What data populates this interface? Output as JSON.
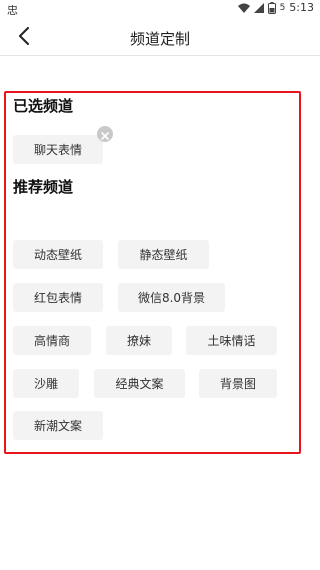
{
  "status_bar": {
    "left_icon": "忠",
    "time": "5:13",
    "battery_level": "5",
    "icons": [
      "wifi-icon",
      "signal-icon",
      "battery-icon"
    ]
  },
  "nav": {
    "title": "频道定制",
    "back_icon": "chevron-left-icon"
  },
  "selected": {
    "title": "已选频道",
    "chips": [
      "聊天表情"
    ]
  },
  "recommended": {
    "title": "推荐频道",
    "chips": [
      "动态壁纸",
      "静态壁纸",
      "红包表情",
      "微信8.0背景",
      "高情商",
      "撩妹",
      "土味情话",
      "沙雕",
      "经典文案",
      "背景图",
      "新潮文案"
    ]
  },
  "colors": {
    "highlight": "#e8141c",
    "chip_bg": "#f3f3f3"
  }
}
